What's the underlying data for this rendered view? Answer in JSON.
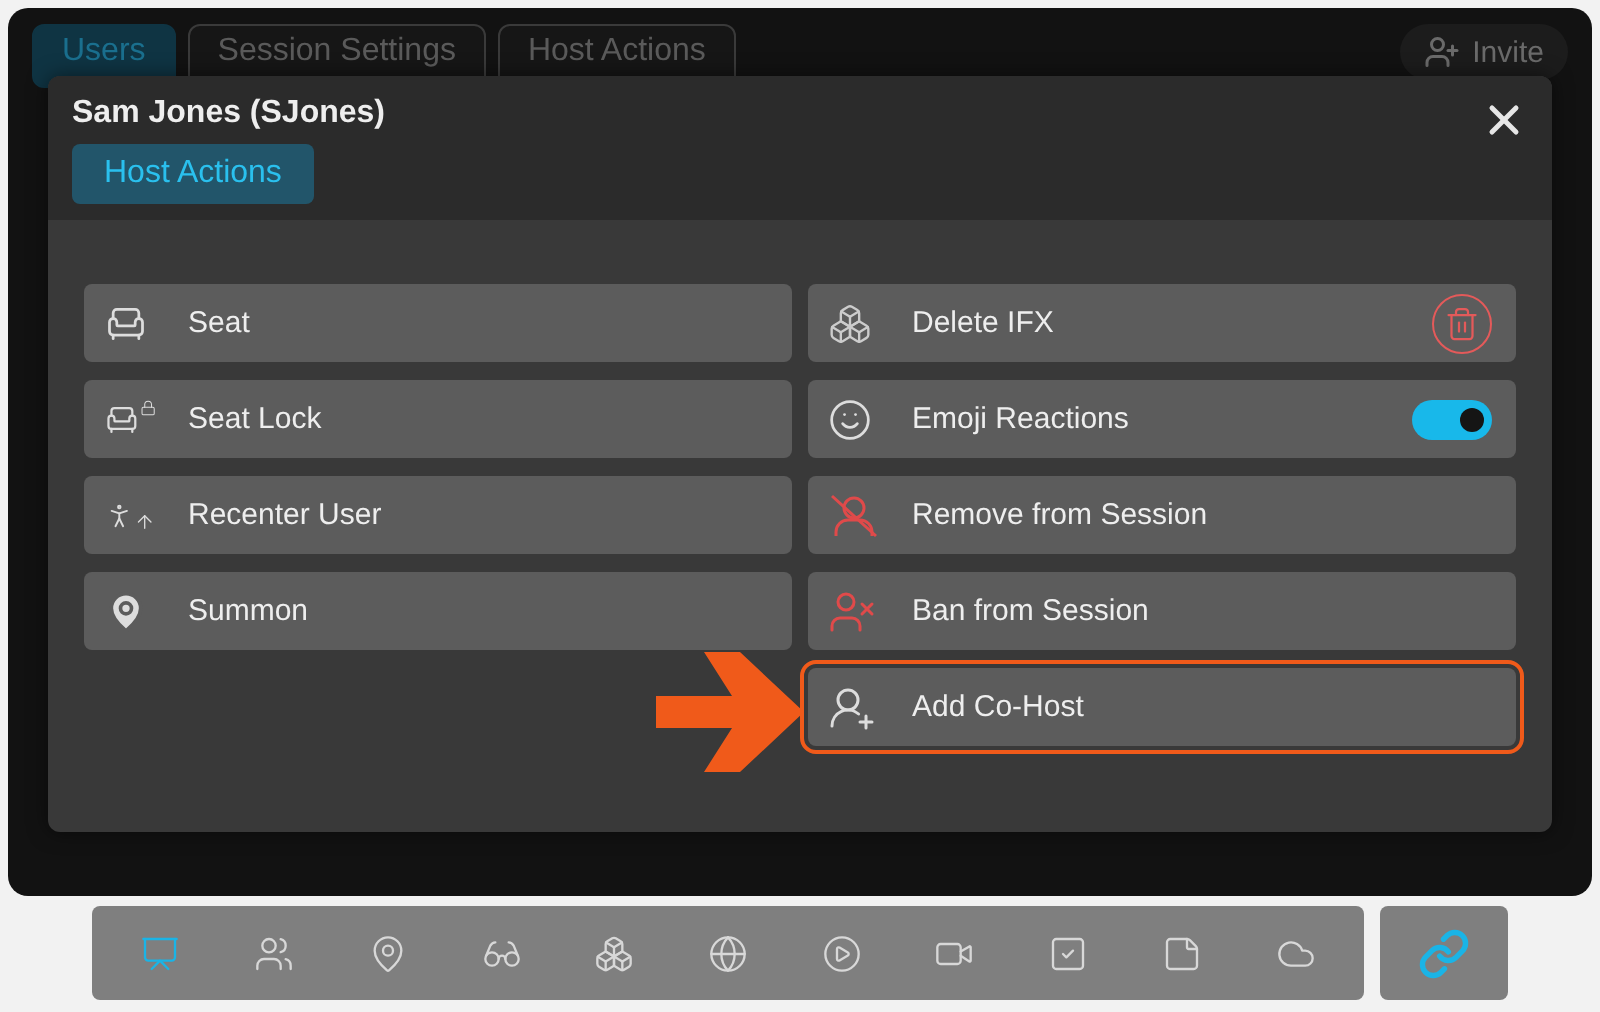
{
  "background_tabs": [
    {
      "label": "Users",
      "selected": true
    },
    {
      "label": "Session Settings",
      "selected": false
    },
    {
      "label": "Host Actions",
      "selected": false
    }
  ],
  "invite_button": {
    "label": "Invite"
  },
  "modal": {
    "title": "Sam Jones (SJones)",
    "tabs": [
      {
        "label": "Host Actions",
        "selected": true
      }
    ],
    "left_actions": [
      {
        "label": "Seat"
      },
      {
        "label": "Seat Lock"
      },
      {
        "label": "Recenter User"
      },
      {
        "label": "Summon"
      }
    ],
    "right_actions": [
      {
        "label": "Delete IFX",
        "kind": "delete"
      },
      {
        "label": "Emoji Reactions",
        "kind": "toggle",
        "on": true
      },
      {
        "label": "Remove from Session"
      },
      {
        "label": "Ban from Session"
      },
      {
        "label": "Add Co-Host",
        "highlighted": true
      }
    ]
  },
  "toolbar": {
    "items": [
      {
        "selected": true
      },
      {
        "selected": false
      },
      {
        "selected": false
      },
      {
        "selected": false
      },
      {
        "selected": false
      },
      {
        "selected": false
      },
      {
        "selected": false
      },
      {
        "selected": false
      },
      {
        "selected": false
      },
      {
        "selected": false
      },
      {
        "selected": false
      }
    ],
    "link": {
      "on": true
    }
  }
}
